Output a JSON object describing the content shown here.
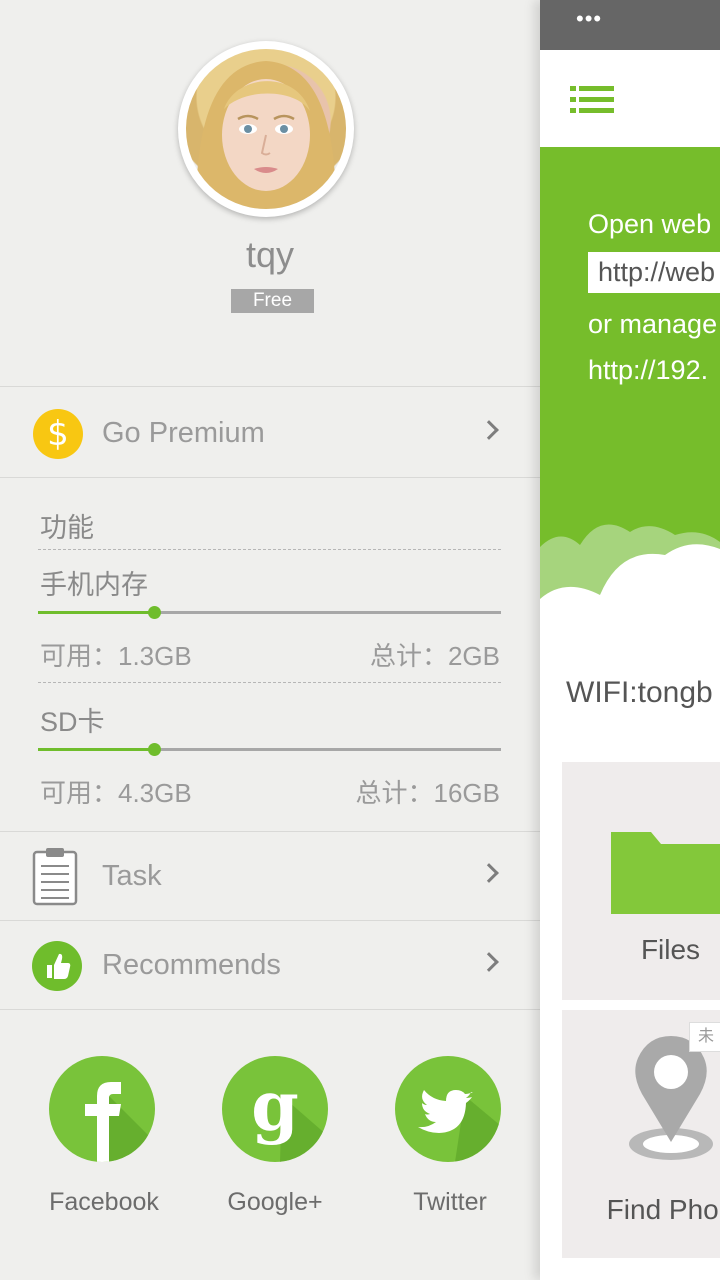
{
  "profile": {
    "username": "tqy",
    "plan_badge": "Free"
  },
  "menu": {
    "premium": "Go Premium",
    "task": "Task",
    "recommends": "Recommends"
  },
  "features": {
    "title": "功能",
    "phone": {
      "label": "手机内存",
      "available": "可用：1.3GB",
      "total": "总计：2GB",
      "used_fraction": 0.25
    },
    "sd": {
      "label": "SD卡",
      "available": "可用：4.3GB",
      "total": "总计：16GB",
      "used_fraction": 0.25
    }
  },
  "social": [
    {
      "name": "Facebook",
      "icon": "facebook-icon"
    },
    {
      "name": "Google+",
      "icon": "google-plus-icon"
    },
    {
      "name": "Twitter",
      "icon": "twitter-icon"
    }
  ],
  "panel": {
    "status_dots": "•••",
    "hero_line1": "Open web",
    "url_box": "http://web",
    "hero_line3": "or manage",
    "hero_line4": "http://192.",
    "wifi": "WIFI:tongb",
    "card1_label": "Files",
    "card2_label": "Find Phon",
    "card2_tag": "未"
  },
  "colors": {
    "accent": "#76bd2b",
    "coin": "#f8c712",
    "drawer_bg": "#efefed"
  }
}
